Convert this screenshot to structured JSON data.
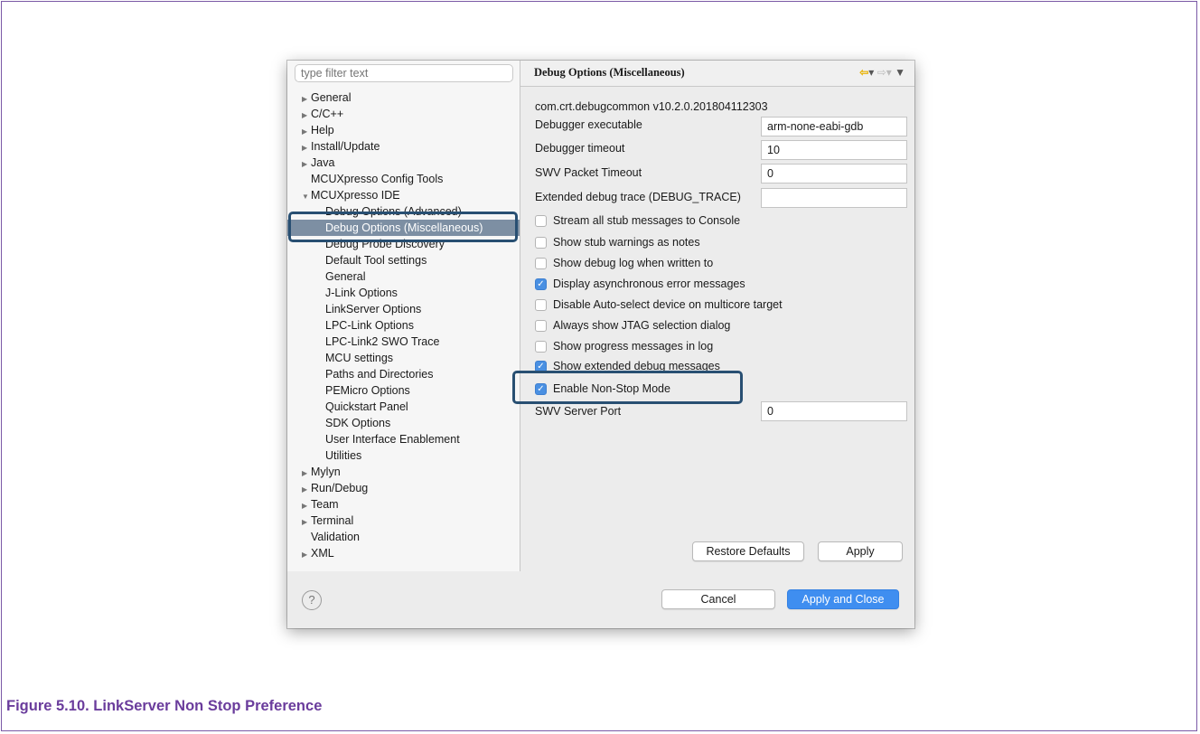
{
  "filter": {
    "placeholder": "type filter text"
  },
  "tree": {
    "items": [
      {
        "label": "General",
        "arrow": "▶"
      },
      {
        "label": "C/C++",
        "arrow": "▶"
      },
      {
        "label": "Help",
        "arrow": "▶"
      },
      {
        "label": "Install/Update",
        "arrow": "▶"
      },
      {
        "label": "Java",
        "arrow": "▶"
      },
      {
        "label": "MCUXpresso Config Tools",
        "arrow": ""
      },
      {
        "label": "MCUXpresso IDE",
        "arrow": "▼"
      },
      {
        "label": "Debug Options (Advanced)",
        "arrow": ""
      },
      {
        "label": "Debug Options (Miscellaneous)",
        "arrow": ""
      },
      {
        "label": "Debug Probe Discovery",
        "arrow": ""
      },
      {
        "label": "Default Tool settings",
        "arrow": ""
      },
      {
        "label": "General",
        "arrow": ""
      },
      {
        "label": "J-Link Options",
        "arrow": ""
      },
      {
        "label": "LinkServer Options",
        "arrow": ""
      },
      {
        "label": "LPC-Link Options",
        "arrow": ""
      },
      {
        "label": "LPC-Link2 SWO Trace",
        "arrow": ""
      },
      {
        "label": "MCU settings",
        "arrow": ""
      },
      {
        "label": "Paths and Directories",
        "arrow": ""
      },
      {
        "label": "PEMicro Options",
        "arrow": ""
      },
      {
        "label": "Quickstart Panel",
        "arrow": ""
      },
      {
        "label": "SDK Options",
        "arrow": ""
      },
      {
        "label": "User Interface Enablement",
        "arrow": ""
      },
      {
        "label": "Utilities",
        "arrow": ""
      },
      {
        "label": "Mylyn",
        "arrow": "▶"
      },
      {
        "label": "Run/Debug",
        "arrow": "▶"
      },
      {
        "label": "Team",
        "arrow": "▶"
      },
      {
        "label": "Terminal",
        "arrow": "▶"
      },
      {
        "label": "Validation",
        "arrow": ""
      },
      {
        "label": "XML",
        "arrow": "▶"
      }
    ]
  },
  "page": {
    "title": "Debug Options (Miscellaneous)",
    "nav_back": "⇦",
    "nav_menu": "▾",
    "nav_forward": "⇨",
    "nav_dropdown": "▼",
    "version": "com.crt.debugcommon v10.2.0.201804112303",
    "fields": [
      {
        "label": "Debugger executable",
        "value": "arm-none-eabi-gdb"
      },
      {
        "label": "Debugger timeout",
        "value": "10"
      },
      {
        "label": "SWV Packet Timeout",
        "value": "0"
      },
      {
        "label": "Extended debug trace (DEBUG_TRACE)",
        "value": ""
      }
    ],
    "checkboxes": [
      {
        "label": "Stream all stub messages to Console",
        "checked": false
      },
      {
        "label": "Show stub warnings as notes",
        "checked": false
      },
      {
        "label": "Show debug log when written to",
        "checked": false
      },
      {
        "label": "Display asynchronous error messages",
        "checked": true
      },
      {
        "label": "Disable Auto-select device on multicore target",
        "checked": false
      },
      {
        "label": "Always show JTAG selection dialog",
        "checked": false
      },
      {
        "label": "Show progress messages in log",
        "checked": false
      },
      {
        "label": "Show extended debug messages",
        "checked": true
      },
      {
        "label": "Enable Non-Stop Mode",
        "checked": true
      }
    ],
    "swv_port": {
      "label": "SWV Server Port",
      "value": "0"
    },
    "restore_defaults": "Restore Defaults",
    "apply": "Apply"
  },
  "footer": {
    "help": "?",
    "cancel": "Cancel",
    "apply_close": "Apply and Close"
  },
  "checkmark": "✓",
  "caption": "Figure 5.10. LinkServer Non Stop Preference",
  "colors": {
    "caption": "#6a3c9c",
    "highlight": "#284f72",
    "primary_button": "#3f8ef0",
    "selection": "#7d8fa3"
  }
}
